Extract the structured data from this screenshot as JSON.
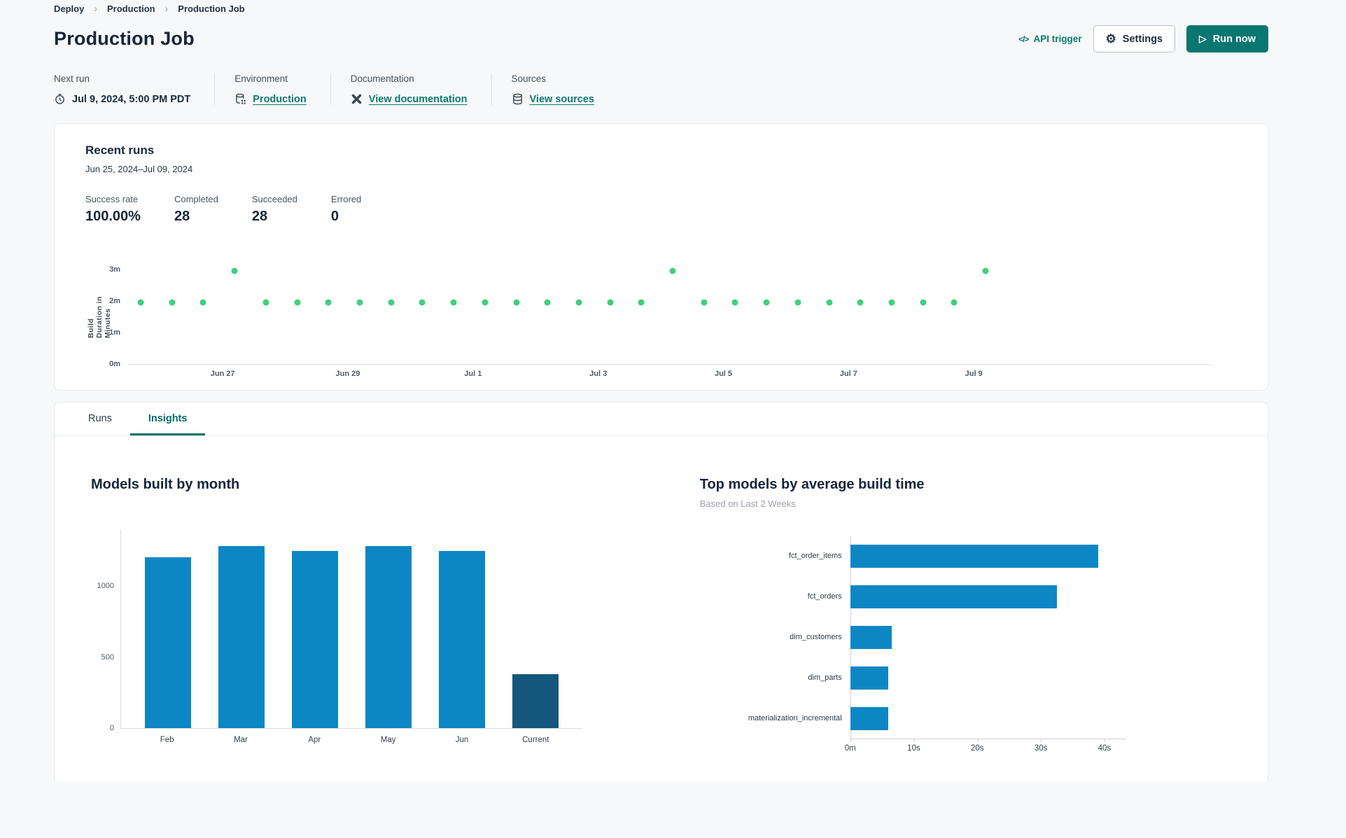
{
  "breadcrumb": {
    "separator": "›",
    "items": [
      {
        "label": "Deploy"
      },
      {
        "label": "Production"
      },
      {
        "label": "Production Job"
      }
    ]
  },
  "header": {
    "title": "Production Job",
    "api_trigger_label": "API trigger",
    "api_trigger_glyph": "</>",
    "settings_label": "Settings",
    "settings_glyph": "⚙",
    "run_now_label": "Run now",
    "run_now_glyph": "▷"
  },
  "meta": {
    "next_run": {
      "label": "Next run",
      "value": "Jul 9, 2024, 5:00 PM PDT"
    },
    "environment": {
      "label": "Environment",
      "value": "Production"
    },
    "documentation": {
      "label": "Documentation",
      "value": "View documentation"
    },
    "sources": {
      "label": "Sources",
      "value": "View sources"
    }
  },
  "recent_runs": {
    "title": "Recent runs",
    "date_range": "Jun 25, 2024–Jul 09, 2024",
    "stats": [
      {
        "label": "Success rate",
        "value": "100.00%"
      },
      {
        "label": "Completed",
        "value": "28"
      },
      {
        "label": "Succeeded",
        "value": "28"
      },
      {
        "label": "Errored",
        "value": "0"
      }
    ]
  },
  "tabs": [
    {
      "label": "Runs",
      "active": false
    },
    {
      "label": "Insights",
      "active": true
    }
  ],
  "colors": {
    "teal_button": "#0a7670",
    "teal_link": "#0a7a6c",
    "scatter_green": "#3fcf7d",
    "bar_blue": "#0d87c3",
    "bar_navy": "#15577c"
  },
  "chart_data": [
    {
      "id": "run-duration-scatter",
      "type": "scatter",
      "ylabel": "Build Duration in Minutes",
      "point_color": "#3fcf7d",
      "y_max_minutes": 3.35,
      "y_ticks": [
        {
          "label": "0m",
          "minutes": 0
        },
        {
          "label": "1m",
          "minutes": 1
        },
        {
          "label": "2m",
          "minutes": 2
        },
        {
          "label": "3m",
          "minutes": 3
        }
      ],
      "x_domain_days": [
        25.5,
        42.8
      ],
      "x_ticks": [
        {
          "label": "Jun 27",
          "day": 27
        },
        {
          "label": "Jun 29",
          "day": 29
        },
        {
          "label": "Jul 1",
          "day": 31
        },
        {
          "label": "Jul 3",
          "day": 33
        },
        {
          "label": "Jul 5",
          "day": 35
        },
        {
          "label": "Jul 7",
          "day": 37
        },
        {
          "label": "Jul 9",
          "day": 39
        }
      ],
      "points": [
        {
          "day": 25.69,
          "minutes": 1.95
        },
        {
          "day": 26.19,
          "minutes": 1.95
        },
        {
          "day": 26.69,
          "minutes": 1.95
        },
        {
          "day": 27.19,
          "minutes": 2.95
        },
        {
          "day": 27.69,
          "minutes": 1.95
        },
        {
          "day": 28.19,
          "minutes": 1.95
        },
        {
          "day": 28.69,
          "minutes": 1.95
        },
        {
          "day": 29.19,
          "minutes": 1.95
        },
        {
          "day": 29.69,
          "minutes": 1.95
        },
        {
          "day": 30.19,
          "minutes": 1.95
        },
        {
          "day": 30.69,
          "minutes": 1.95
        },
        {
          "day": 31.19,
          "minutes": 1.95
        },
        {
          "day": 31.69,
          "minutes": 1.95
        },
        {
          "day": 32.19,
          "minutes": 1.95
        },
        {
          "day": 32.69,
          "minutes": 1.95
        },
        {
          "day": 33.19,
          "minutes": 1.95
        },
        {
          "day": 33.69,
          "minutes": 1.95
        },
        {
          "day": 34.19,
          "minutes": 2.95
        },
        {
          "day": 34.69,
          "minutes": 1.95
        },
        {
          "day": 35.19,
          "minutes": 1.95
        },
        {
          "day": 35.69,
          "minutes": 1.95
        },
        {
          "day": 36.19,
          "minutes": 1.95
        },
        {
          "day": 36.69,
          "minutes": 1.95
        },
        {
          "day": 37.19,
          "minutes": 1.95
        },
        {
          "day": 37.69,
          "minutes": 1.95
        },
        {
          "day": 38.19,
          "minutes": 1.95
        },
        {
          "day": 38.69,
          "minutes": 1.95
        },
        {
          "day": 39.19,
          "minutes": 2.95
        }
      ]
    },
    {
      "id": "models-by-month",
      "type": "bar",
      "title": "Models built by month",
      "categories": [
        "Feb",
        "Mar",
        "Apr",
        "May",
        "Jun",
        "Current"
      ],
      "values": [
        1205,
        1280,
        1245,
        1280,
        1245,
        380
      ],
      "y_ticks": [
        0,
        500,
        1000
      ],
      "y_max": 1400,
      "bar_color": "#0d87c3",
      "highlight_last_color": "#15577c"
    },
    {
      "id": "top-models",
      "type": "bar-horizontal",
      "title": "Top models by average build time",
      "subtitle": "Based on Last 2 Weeks",
      "categories": [
        "fct_order_items",
        "fct_orders",
        "dim_customers",
        "dim_parts",
        "materialization_incremental"
      ],
      "values_seconds": [
        39,
        32.5,
        6.5,
        6,
        6
      ],
      "x_max_seconds": 43.5,
      "x_ticks": [
        {
          "label": "0m",
          "seconds": 0
        },
        {
          "label": "10s",
          "seconds": 10
        },
        {
          "label": "20s",
          "seconds": 20
        },
        {
          "label": "30s",
          "seconds": 30
        },
        {
          "label": "40s",
          "seconds": 40
        }
      ],
      "bar_color": "#0d87c3"
    }
  ]
}
